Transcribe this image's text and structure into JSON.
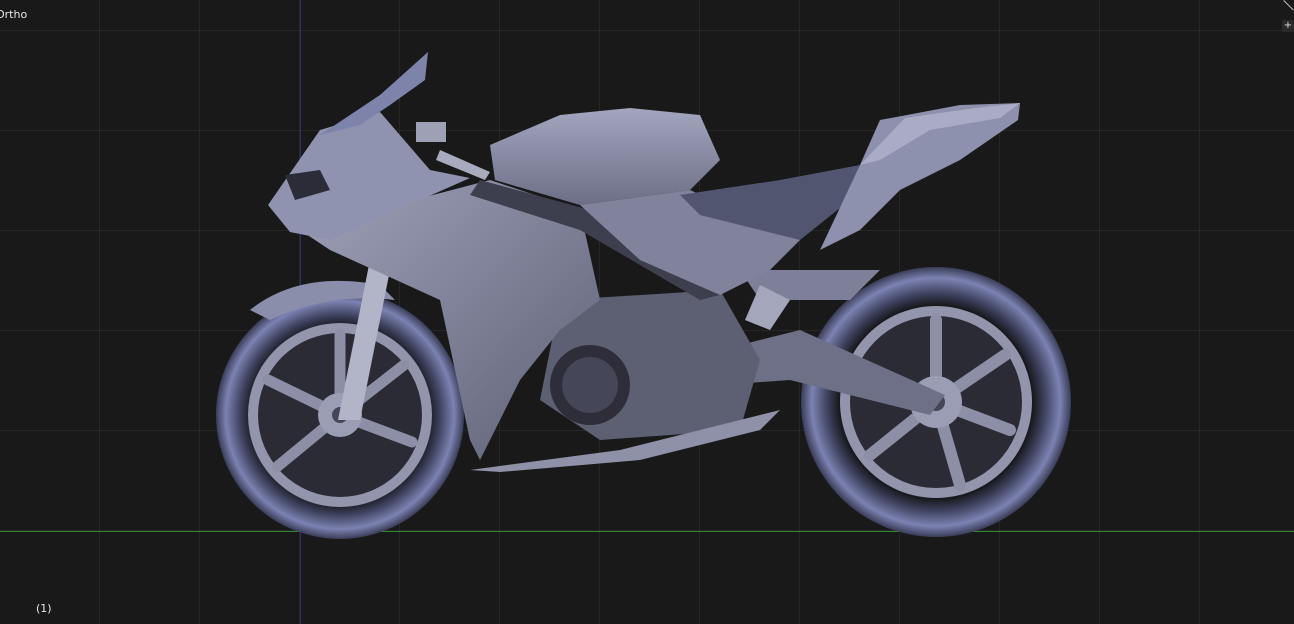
{
  "viewport": {
    "view_label": "Ortho",
    "frame_label": "(1)",
    "corner_button_label": "+",
    "colors": {
      "background": "#191919",
      "x_axis": "#2e8a2e",
      "z_axis": "#2b2f73",
      "model_shade": "#8f93b0"
    }
  }
}
